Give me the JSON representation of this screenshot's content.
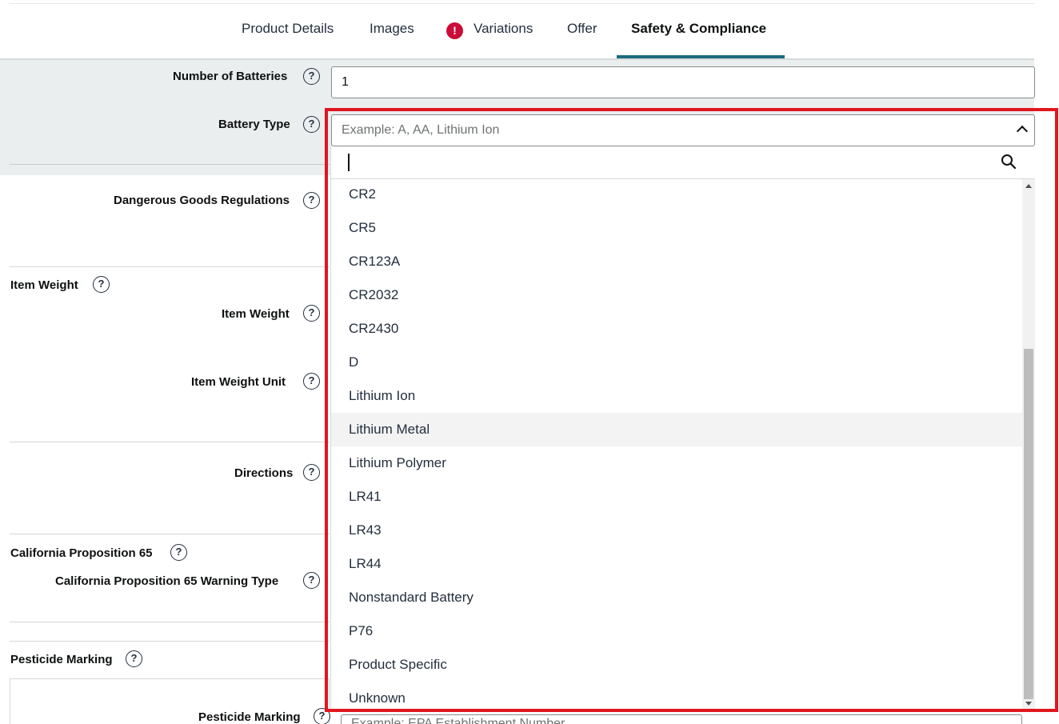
{
  "tabs": [
    {
      "label": "Product Details"
    },
    {
      "label": "Images"
    },
    {
      "label": "Variations",
      "has_error": true
    },
    {
      "label": "Offer"
    },
    {
      "label": "Safety & Compliance",
      "active": true
    }
  ],
  "fields": {
    "number_of_batteries": {
      "label": "Number of Batteries",
      "value": "1"
    },
    "battery_type": {
      "label": "Battery Type",
      "placeholder": "Example: A, AA, Lithium Ion",
      "search_value": ""
    },
    "dangerous_goods": {
      "label": "Dangerous Goods Regulations"
    },
    "item_weight_section": {
      "label": "Item Weight"
    },
    "item_weight": {
      "label": "Item Weight"
    },
    "item_weight_unit": {
      "label": "Item Weight Unit"
    },
    "directions": {
      "label": "Directions"
    },
    "prop65_section": {
      "label": "California Proposition 65"
    },
    "prop65_warning": {
      "label": "California Proposition 65 Warning Type"
    },
    "pesticide_section": {
      "label": "Pesticide Marking"
    },
    "pesticide_marking": {
      "label": "Pesticide Marking",
      "placeholder": "Example: EPA Establishment Number"
    }
  },
  "battery_options": [
    "CR2",
    "CR5",
    "CR123A",
    "CR2032",
    "CR2430",
    "D",
    "Lithium Ion",
    "Lithium Metal",
    "Lithium Polymer",
    "LR41",
    "LR43",
    "LR44",
    "Nonstandard Battery",
    "P76",
    "Product Specific",
    "Unknown"
  ],
  "hovered_option": "Lithium Metal",
  "colors": {
    "accent_underline": "#1e6a7f",
    "error": "#cc0c39",
    "highlight_box": "#e0161f"
  },
  "icons": {
    "help": "question-circle-icon",
    "error": "exclamation-circle-icon",
    "search": "search-icon",
    "caret": "chevron-up-icon"
  }
}
